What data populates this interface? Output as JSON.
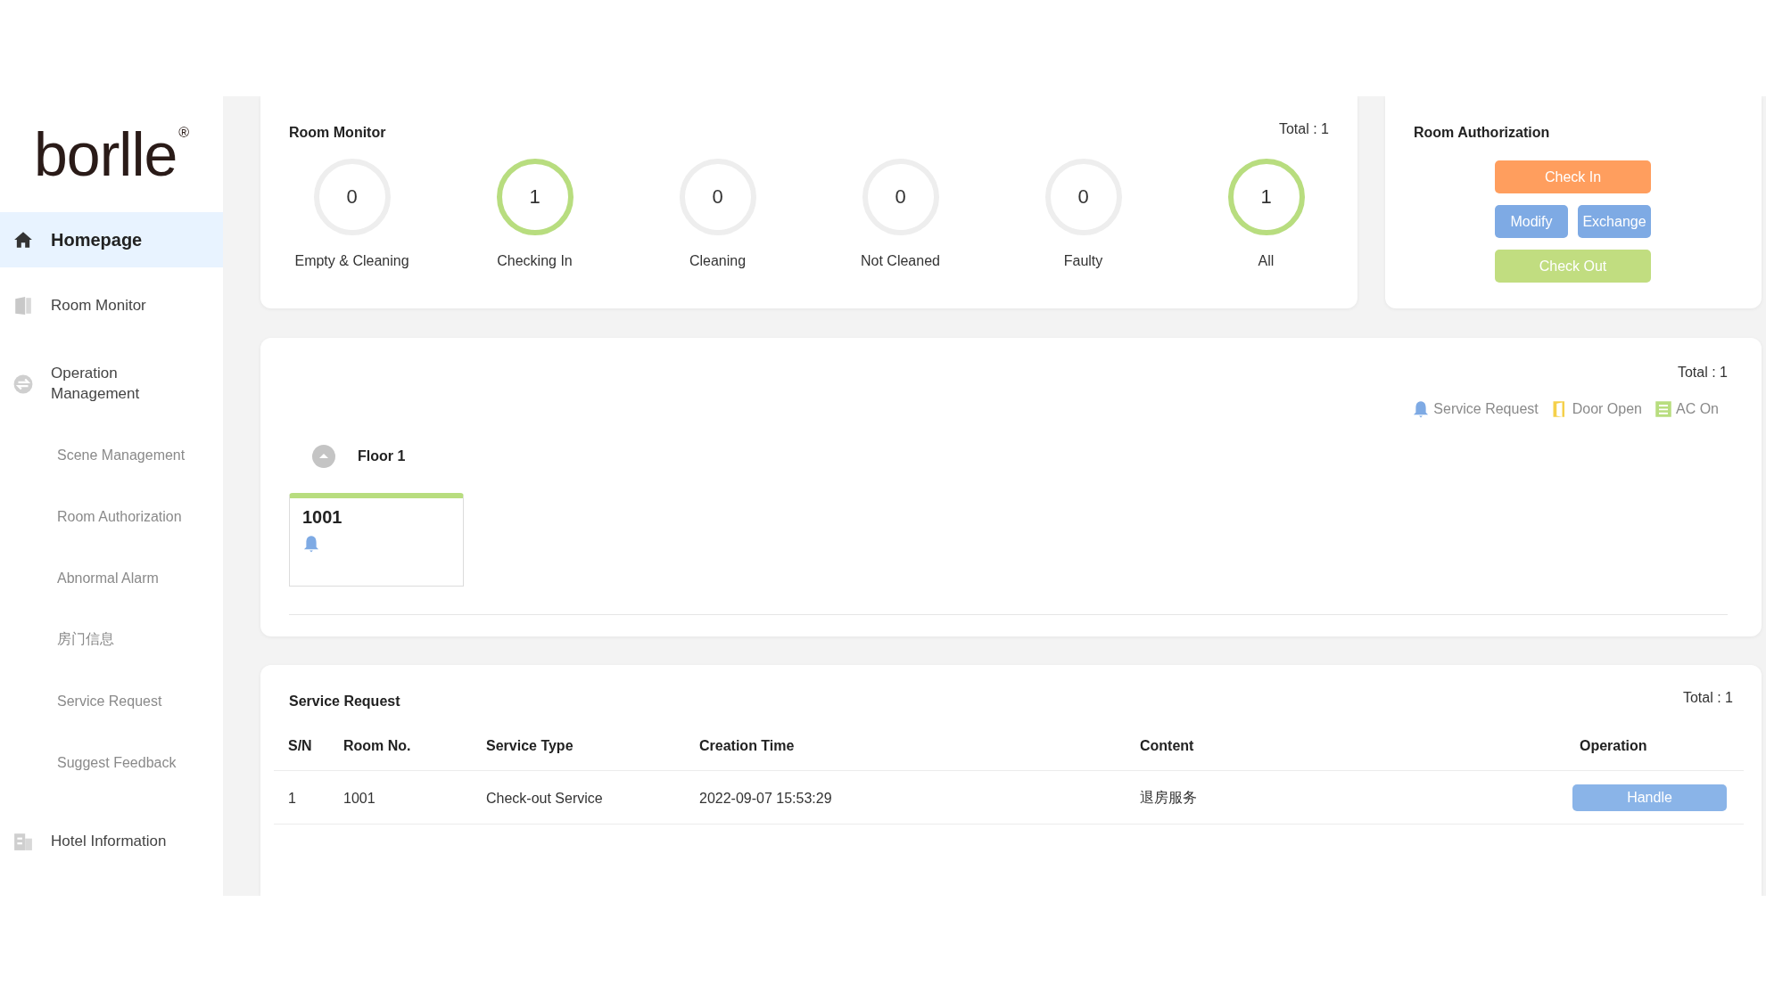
{
  "logo": {
    "text": "borlle",
    "mark": "®"
  },
  "sidebar": {
    "items": [
      {
        "label": "Homepage",
        "selected": true
      },
      {
        "label": "Room  Monitor",
        "selected": false
      },
      {
        "label": "Operation Management",
        "selected": false,
        "children": [
          {
            "label": "Scene Management",
            "selected": false
          },
          {
            "label": "Room Authorization",
            "selected": false
          },
          {
            "label": "Abnormal Alarm",
            "selected": false
          },
          {
            "label": "房门信息",
            "selected": false
          },
          {
            "label": "Service Request",
            "selected": false
          },
          {
            "label": "Suggest Feedback",
            "selected": false
          }
        ]
      },
      {
        "label": "Hotel Information",
        "selected": false
      }
    ]
  },
  "room_monitor": {
    "title": "Room Monitor",
    "total": "Total : 1",
    "stats": [
      {
        "value": "0",
        "label": "Empty & Cleaning",
        "active": false
      },
      {
        "value": "1",
        "label": "Checking In",
        "active": true
      },
      {
        "value": "0",
        "label": "Cleaning",
        "active": false
      },
      {
        "value": "0",
        "label": "Not Cleaned",
        "active": false
      },
      {
        "value": "0",
        "label": "Faulty",
        "active": false
      },
      {
        "value": "1",
        "label": "All",
        "active": true
      }
    ]
  },
  "room_authorization": {
    "title": "Room Authorization",
    "buttons": [
      {
        "label": "Check In",
        "color": "#ff9e5e"
      },
      {
        "label": "Modify",
        "color": "#7eaae4"
      },
      {
        "label": "Exchange",
        "color": "#7eaae4"
      },
      {
        "label": "Check Out",
        "color": "#c1dd80"
      }
    ]
  },
  "floors": {
    "total": "Total : 1",
    "legend": [
      {
        "label": "Service Request",
        "color": "#7eaae4"
      },
      {
        "label": "Door Open",
        "color": "#f5d04a"
      },
      {
        "label": "AC On",
        "color": "#b8dd7f"
      }
    ],
    "floor": {
      "label": "Floor 1",
      "expanded": true,
      "rooms": [
        {
          "number": "1001",
          "color": "#b8dd7f",
          "service_request": true
        }
      ]
    }
  },
  "service_request": {
    "title": "Service Request",
    "total": "Total : 1",
    "columns": [
      "S/N",
      "Room No.",
      "Service Type",
      "Creation Time",
      "Content",
      "Operation"
    ],
    "rows": [
      {
        "cells": [
          "1",
          "1001",
          "Check-out Service",
          "2022-09-07 15:53:29",
          "退房服务"
        ],
        "action": "Handle"
      }
    ]
  }
}
